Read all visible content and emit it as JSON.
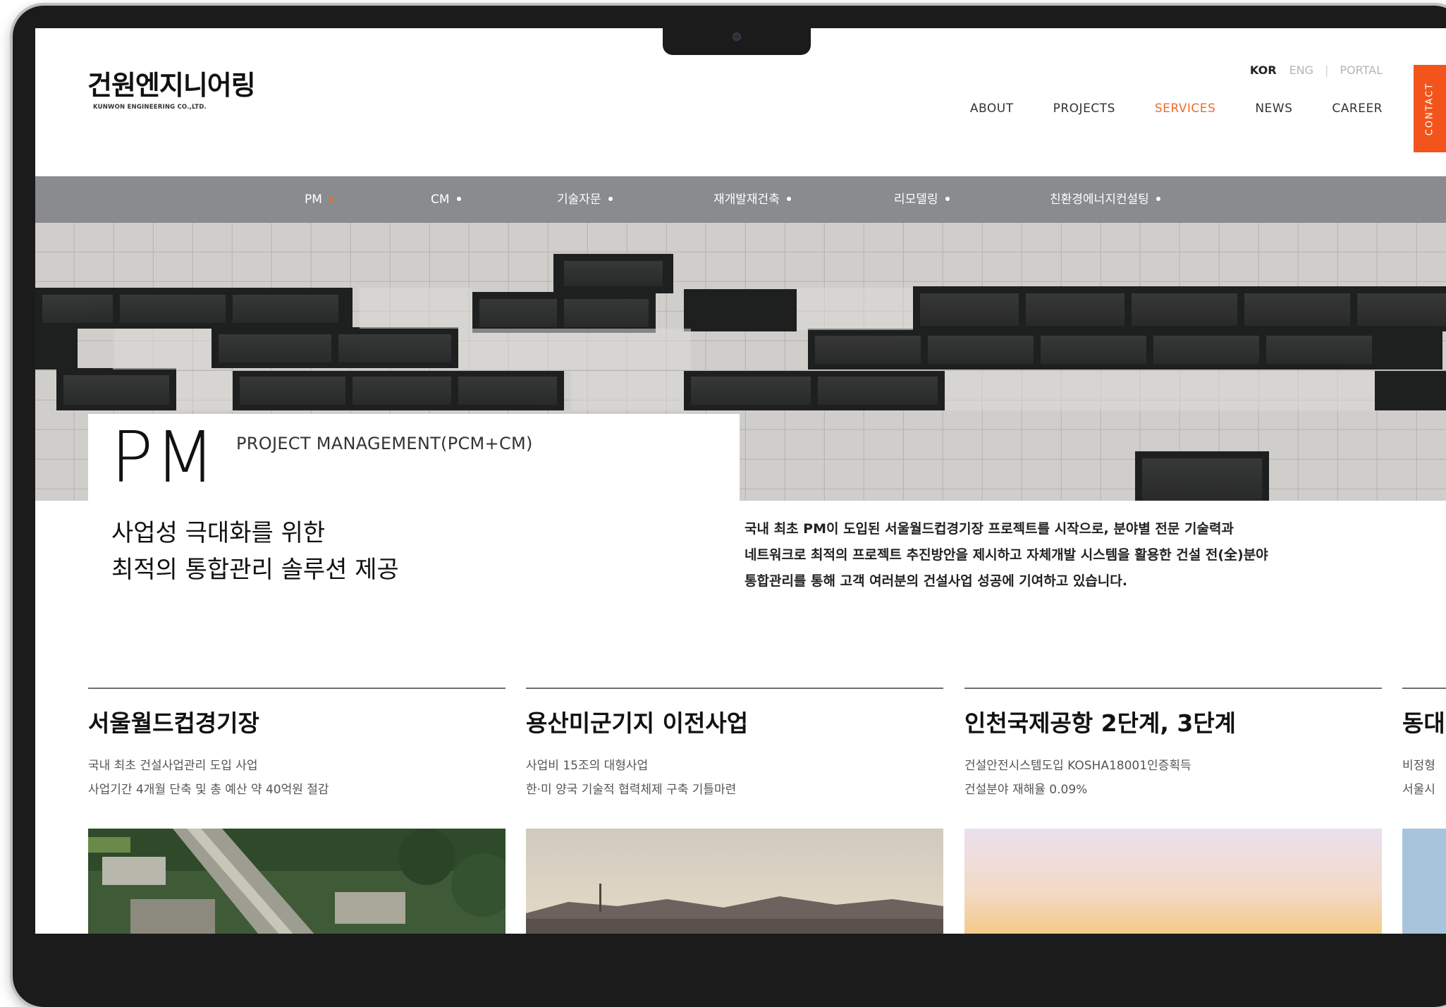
{
  "header": {
    "logo_text": "건원엔지니어링",
    "logo_subtext": "KUNWON ENGINEERING CO.,LTD.",
    "lang": {
      "kor": "KOR",
      "eng": "ENG",
      "portal": "PORTAL"
    },
    "nav": [
      {
        "label": "ABOUT"
      },
      {
        "label": "PROJECTS"
      },
      {
        "label": "SERVICES",
        "active": true
      },
      {
        "label": "NEWS"
      },
      {
        "label": "CAREER"
      }
    ],
    "contact_label": "CONTACT",
    "accent_color": "#f26a2c"
  },
  "subnav": [
    {
      "label": "PM",
      "active": true
    },
    {
      "label": "CM"
    },
    {
      "label": "기술자문"
    },
    {
      "label": "재개발재건축"
    },
    {
      "label": "리모델링"
    },
    {
      "label": "친환경에너지컨설팅"
    }
  ],
  "intro": {
    "title": "PM",
    "subtitle": "PROJECT MANAGEMENT(PCM+CM)",
    "headline_line1": "사업성 극대화를 위한",
    "headline_line2": "최적의 통합관리 솔루션 제공",
    "description_lines": [
      "국내 최초 PM이 도입된 서울월드컵경기장 프로젝트를 시작으로, 분야별 전문 기술력과",
      "네트워크로 최적의 프로젝트 추진방안을 제시하고 자체개발 시스템을 활용한 건설 전(全)분야",
      "통합관리를 통해 고객 여러분의 건설사업 성공에 기여하고 있습니다."
    ]
  },
  "projects": [
    {
      "title": "서울월드컵경기장",
      "line1": "국내 최초 건설사업관리 도입 사업",
      "line2": "사업기간 4개월 단축 및 총 예산 약 40억원 절감"
    },
    {
      "title": "용산미군기지 이전사업",
      "line1": "사업비 15조의 대형사업",
      "line2": "한·미 양국 기술적 협력체제 구축 기틀마련"
    },
    {
      "title": "인천국제공항 2단계, 3단계",
      "line1": "건설안전시스템도입 KOSHA18001인증획득",
      "line2": "건설분야 재해율 0.09%"
    },
    {
      "title": "동대",
      "line1": "비정형",
      "line2": "서울시"
    }
  ]
}
